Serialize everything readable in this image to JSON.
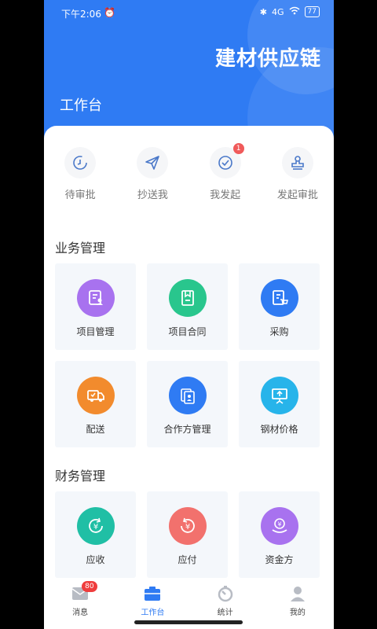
{
  "status_bar": {
    "time": "下午2:06",
    "network": "4G",
    "battery": "77"
  },
  "header": {
    "brand": "建材供应链",
    "title": "工作台"
  },
  "quick_actions": [
    {
      "label": "待审批",
      "icon": "clock-icon"
    },
    {
      "label": "抄送我",
      "icon": "send-icon"
    },
    {
      "label": "我发起",
      "icon": "check-circle-icon",
      "badge": "1"
    },
    {
      "label": "发起审批",
      "icon": "stamp-icon"
    }
  ],
  "sections": {
    "business": {
      "title": "业务管理",
      "items": [
        {
          "label": "项目管理",
          "color": "#a872ef"
        },
        {
          "label": "项目合同",
          "color": "#29c68d"
        },
        {
          "label": "采购",
          "color": "#2f7bf3"
        },
        {
          "label": "配送",
          "color": "#f28b2d"
        },
        {
          "label": "合作方管理",
          "color": "#2f7bf3"
        },
        {
          "label": "钢材价格",
          "color": "#27b4ea"
        }
      ]
    },
    "finance": {
      "title": "财务管理",
      "items": [
        {
          "label": "应收",
          "color": "#20bfa5"
        },
        {
          "label": "应付",
          "color": "#f2716d"
        },
        {
          "label": "资金方",
          "color": "#a872ef"
        }
      ]
    }
  },
  "tabbar": [
    {
      "label": "消息",
      "badge": "80"
    },
    {
      "label": "工作台",
      "active_color": "#2f7bf3"
    },
    {
      "label": "统计"
    },
    {
      "label": "我的"
    }
  ]
}
